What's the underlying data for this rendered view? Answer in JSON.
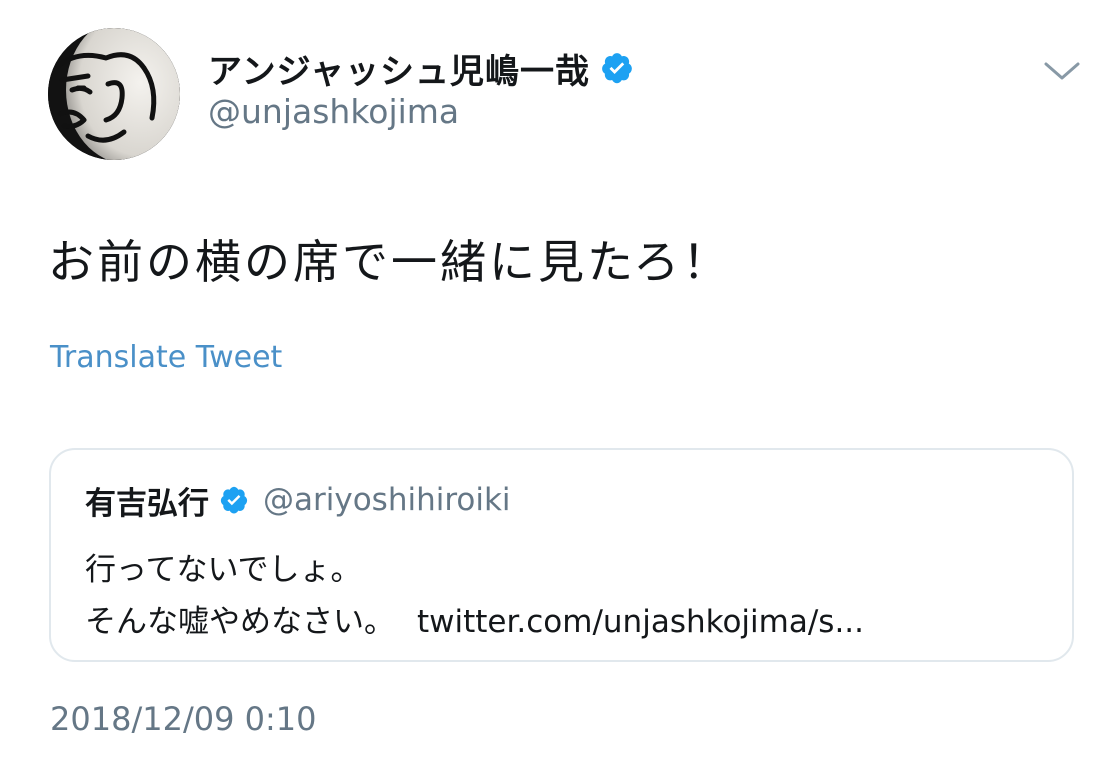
{
  "author": {
    "display_name": "アンジャッシュ児嶋一哉",
    "handle": "@unjashkojima",
    "verified": true
  },
  "tweet": {
    "text": "お前の横の席で一緒に見たろ！",
    "translate_label": "Translate Tweet",
    "timestamp": "2018/12/09 0:10"
  },
  "quoted_tweet": {
    "display_name": "有吉弘行",
    "handle": "@ariyoshihiroiki",
    "verified": true,
    "line1": "行ってないでしょ。",
    "line2": "そんな嘘やめなさい。",
    "link": "twitter.com/unjashkojima/s..."
  },
  "icons": {
    "verified": "verified-badge-icon",
    "menu": "chevron-down-icon",
    "avatar": "avatar-image"
  },
  "colors": {
    "text_primary": "#14171a",
    "text_secondary": "#657786",
    "link_blue": "#4a90c8",
    "verified_blue": "#1da1f2",
    "card_border": "#e1e8ed"
  }
}
